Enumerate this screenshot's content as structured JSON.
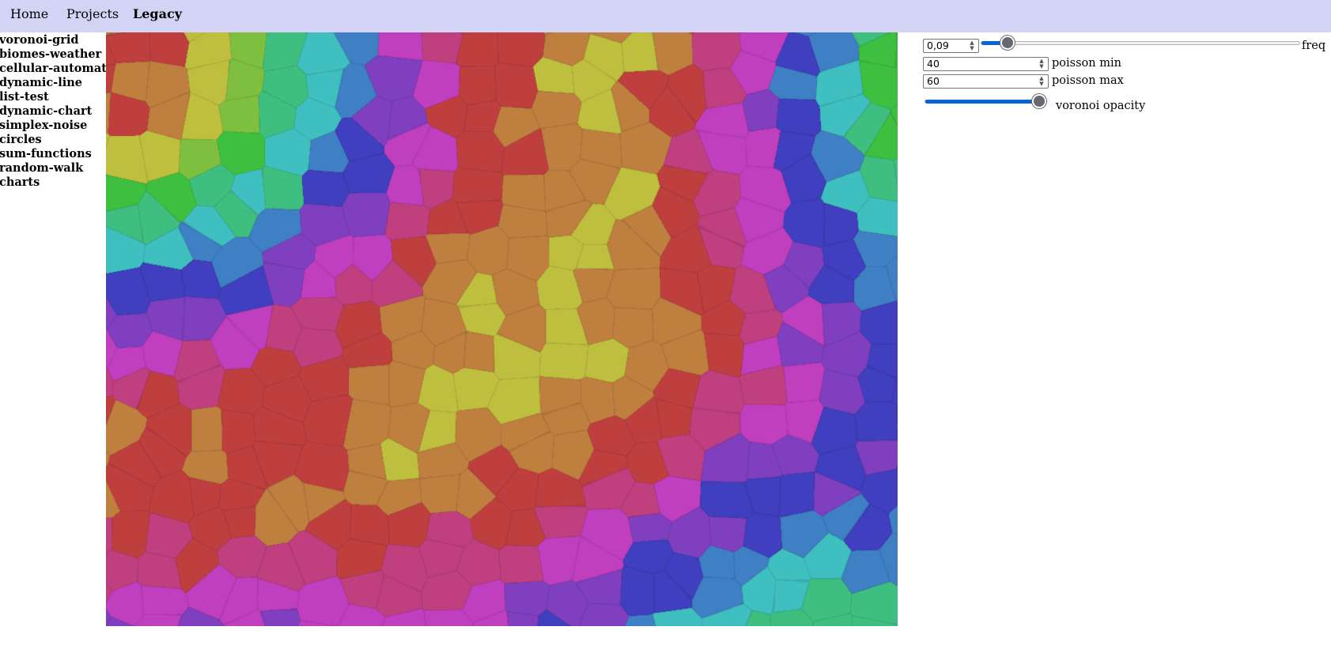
{
  "nav": {
    "home": "Home",
    "projects": "Projects",
    "legacy": "Legacy"
  },
  "sidebar": {
    "items": [
      {
        "label": "voronoi-grid"
      },
      {
        "label": "biomes-weather"
      },
      {
        "label": "cellular-automata"
      },
      {
        "label": "dynamic-line"
      },
      {
        "label": "list-test"
      },
      {
        "label": "dynamic-chart"
      },
      {
        "label": "simplex-noise"
      },
      {
        "label": "circles"
      },
      {
        "label": "sum-functions"
      },
      {
        "label": "random-walk"
      },
      {
        "label": "charts"
      }
    ]
  },
  "controls": {
    "freq": {
      "value": "0,09",
      "label": "freq",
      "slider_fraction": 0.065
    },
    "poisson_min": {
      "value": "40",
      "label": "poisson min"
    },
    "poisson_max": {
      "value": "60",
      "label": "poisson max"
    },
    "voronoi_opacity": {
      "label": "voronoi opacity",
      "slider_fraction": 1.0
    }
  },
  "palette": {
    "nav_background": "#d3d3f5",
    "slider_accent": "#0a63d8",
    "cell_colors": [
      "#3f7fc4",
      "#3fbfbf",
      "#3fbf7f",
      "#3fbf3f",
      "#7fbf3f",
      "#bfbf3f",
      "#bf7f3f",
      "#bf3f3f",
      "#bf3f7f",
      "#bf3fbf",
      "#7f3fbf",
      "#3f3fbf"
    ]
  }
}
